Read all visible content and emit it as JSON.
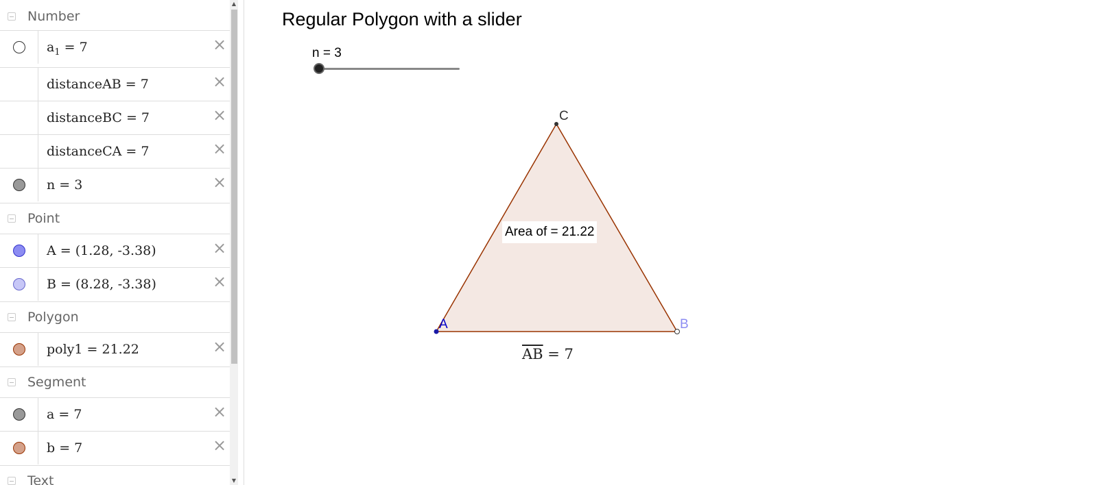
{
  "algebra": {
    "groups": {
      "number": "Number",
      "point": "Point",
      "polygon": "Polygon",
      "segment": "Segment",
      "text": "Text"
    },
    "rows": {
      "a1": {
        "name": "a",
        "sub": "1",
        "value": "= 7"
      },
      "distanceAB": "distanceAB = 7",
      "distanceBC": "distanceBC = 7",
      "distanceCA": "distanceCA = 7",
      "n": "n = 3",
      "A": "A = (1.28, -3.38)",
      "B": "B = (8.28, -3.38)",
      "poly1": "poly1 = 21.22",
      "seg_a": "a = 7",
      "seg_b": "b = 7"
    },
    "delete_glyph": "×",
    "colors": {
      "point_A": "#8c8cf2",
      "point_B": "#c7c7f7",
      "polygon": "#d4a18a",
      "segment_a": "#999999",
      "segment_b": "#d4a18a",
      "n": "#999999"
    }
  },
  "graphics": {
    "title": "Regular Polygon with a slider",
    "slider": {
      "label": "n = 3",
      "value": 3
    },
    "labels": {
      "A": "A",
      "B": "B",
      "C": "C"
    },
    "area_text": "Area of  = 21.22",
    "ab_overline": "AB",
    "ab_value": " = 7",
    "colors": {
      "polygon_stroke": "#993300",
      "polygon_fill": "#f4e8e3",
      "point_A_label": "#0000cc",
      "point_B_label": "#8c8cf2",
      "point_C_label": "#333333"
    }
  }
}
